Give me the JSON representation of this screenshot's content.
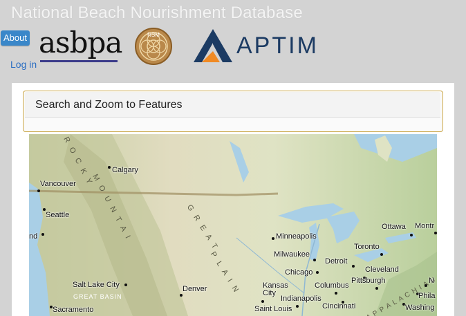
{
  "header": {
    "site_title": "National Beach Nourishment Database",
    "about_label": "About",
    "login_label": "Log in",
    "logos": {
      "asbpa": "asbpa",
      "rsm": "RSM",
      "aptim": "APTIM"
    }
  },
  "panel": {
    "search_title": "Search and Zoom to Features"
  },
  "map": {
    "cities": [
      {
        "name": "Calgary"
      },
      {
        "name": "Vancouver"
      },
      {
        "name": "Seattle"
      },
      {
        "name": "nd"
      },
      {
        "name": "Salt Lake City"
      },
      {
        "name": "Denver"
      },
      {
        "name": "Sacramento"
      },
      {
        "name": "Minneapolis"
      },
      {
        "name": "Milwaukee"
      },
      {
        "name": "Chicago"
      },
      {
        "name": "Detroit"
      },
      {
        "name": "Toronto"
      },
      {
        "name": "Ottawa"
      },
      {
        "name": "Montr"
      },
      {
        "name": "Cleveland"
      },
      {
        "name": "Pittsburgh"
      },
      {
        "name": "Columbus"
      },
      {
        "name": "Kansas City"
      },
      {
        "name": "Indianapolis"
      },
      {
        "name": "Cincinnati"
      },
      {
        "name": "Saint Louis"
      },
      {
        "name": "N"
      },
      {
        "name": "Phila"
      },
      {
        "name": "Washing"
      }
    ],
    "regions": [
      "R O C K Y",
      "M O U N T A I",
      "G R E A T",
      "P L A I N",
      "GREAT BASIN",
      "A P P A L A C H I A N"
    ]
  },
  "colors": {
    "about_button": "#3a87c9",
    "link": "#2c6fc2",
    "search_border": "#c7a241",
    "water": "#a9cfe6",
    "aptim_navy": "#1c3b63",
    "aptim_orange": "#f08a24"
  }
}
